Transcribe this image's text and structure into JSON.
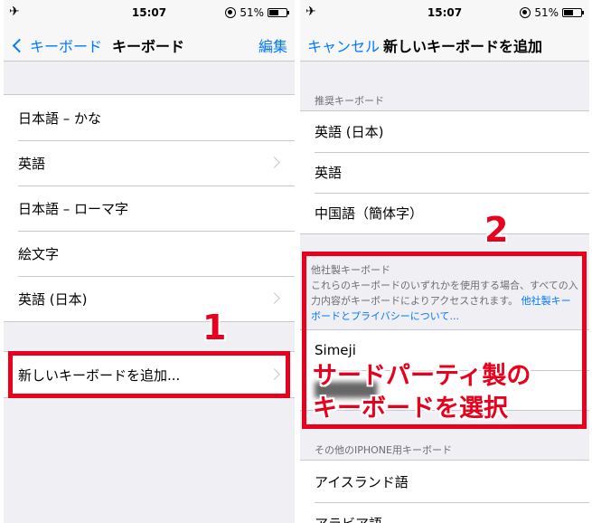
{
  "left": {
    "status": {
      "time": "15:07",
      "battery": "51%"
    },
    "nav": {
      "back": "キーボード",
      "title": "キーボード",
      "action": "編集"
    },
    "keyboards": [
      "日本語 – かな",
      "英語",
      "日本語 – ローマ字",
      "絵文字",
      "英語 (日本)"
    ],
    "add_keyboard": "新しいキーボードを追加..."
  },
  "right": {
    "status": {
      "time": "15:07",
      "battery": "51%"
    },
    "nav": {
      "cancel": "キャンセル",
      "title": "新しいキーボードを追加"
    },
    "suggested_header": "推奨キーボード",
    "suggested": [
      "英語 (日本)",
      "英語",
      "中国語（簡体字）"
    ],
    "third_party_header": "他社製キーボード",
    "third_party_note": "これらのキーボードのいずれかを使用する場合、すべての入力内容がキーボードによりアクセスされます。",
    "third_party_link": "他社製キーボードとプライバシーについて...",
    "third_party": [
      "Simeji"
    ],
    "other_header": "その他のIPHONE用キーボード",
    "other": [
      "アイスランド語",
      "アラビア語"
    ]
  },
  "annotations": {
    "step1": "1",
    "step2": "2",
    "callout_line1": "サードパーティ製の",
    "callout_line2": "キーボードを選択"
  },
  "colors": {
    "accent": "#007aff",
    "highlight": "#e8001c"
  }
}
